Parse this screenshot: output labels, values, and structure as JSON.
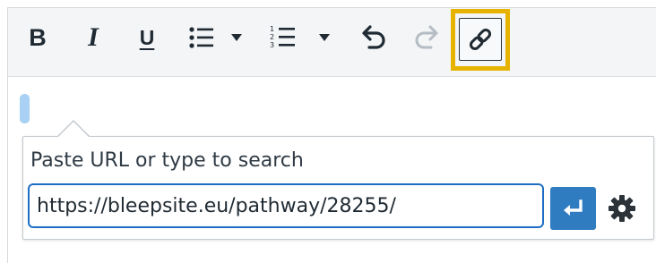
{
  "toolbar": {
    "bold_label": "B",
    "italic_label": "I",
    "underline_label": "U",
    "icons": [
      "bold-icon",
      "italic-icon",
      "underline-icon",
      "bulleted-list-icon",
      "numbered-list-icon",
      "undo-icon",
      "redo-icon",
      "link-icon",
      "chevron-down-icon"
    ],
    "highlight_color": "#e6b400"
  },
  "link_popup": {
    "label": "Paste URL or type to search",
    "url_value": "https://bleepsite.eu/pathway/28255/",
    "submit_icon": "enter-icon",
    "settings_icon": "gear-icon",
    "accent_color": "#2f7cc1"
  }
}
